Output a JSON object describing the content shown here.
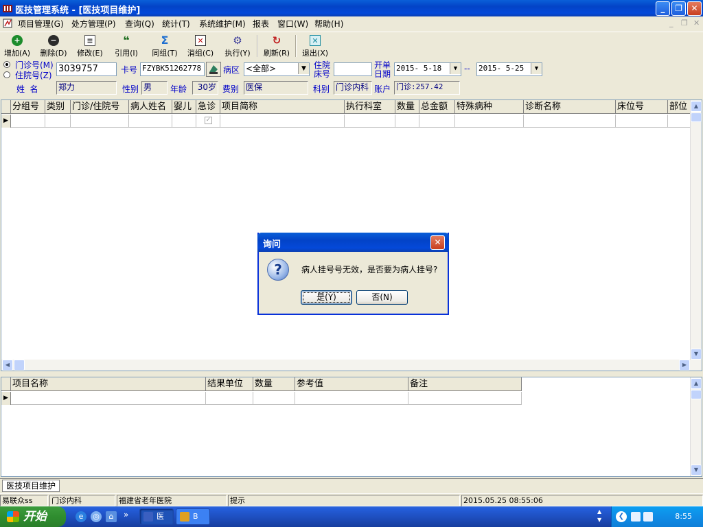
{
  "window": {
    "title": "医技管理系统 - [医技项目维护]",
    "controls": {
      "minimize": "_",
      "restore": "❐",
      "close": "✕"
    }
  },
  "menu": {
    "items": [
      "项目管理(G)",
      "处方管理(P)",
      "查询(Q)",
      "统计(T)",
      "系统维护(M)",
      "报表",
      "窗口(W)",
      "帮助(H)"
    ],
    "mdi_controls": {
      "minimize": "_",
      "restore": "❐",
      "close": "✕"
    }
  },
  "toolbar": {
    "buttons": [
      {
        "label": "增加(A)",
        "icon": "plus-circle-icon",
        "color": "#1C8C2C"
      },
      {
        "label": "删除(D)",
        "icon": "minus-circle-icon",
        "color": "#2C2C2C"
      },
      {
        "label": "修改(E)",
        "icon": "edit-document-icon",
        "color": "#555555"
      },
      {
        "label": "引用(I)",
        "icon": "quote-icon",
        "color": "#1C6C1C"
      },
      {
        "label": "同组(T)",
        "icon": "sigma-icon",
        "color": "#1F6FD0"
      },
      {
        "label": "消组(C)",
        "icon": "delete-group-icon",
        "color": "#C02020"
      },
      {
        "label": "执行(Y)",
        "icon": "gear-icon",
        "color": "#3A3A9A"
      },
      {
        "label": "刷新(R)",
        "icon": "refresh-icon",
        "color": "#C02020"
      },
      {
        "label": "退出(X)",
        "icon": "exit-icon",
        "color": "#1C8CA0"
      }
    ]
  },
  "form": {
    "radio_outpatient": "门诊号(M)",
    "radio_inpatient": "住院号(Z)",
    "patient_no": "3039757",
    "card_label": "卡号",
    "card_no": "FZYBK51262778",
    "ward_label": "病区",
    "ward_value": "<全部>",
    "bed_label_1": "住院",
    "bed_label_2": "床号",
    "bed_value": "",
    "order_date_label_1": "开单",
    "order_date_label_2": "日期",
    "date_from": "2015- 5-18",
    "date_sep": "--",
    "date_to": "2015- 5-25",
    "name_label": "姓  名",
    "name": "郑力",
    "gender_label": "性别",
    "gender": "男",
    "age_label": "年龄",
    "age": "30岁",
    "fee_label": "费别",
    "fee_type": "医保",
    "dept_label": "科别",
    "dept": "门诊内科",
    "account_label": "账户",
    "account": "门诊:257.42"
  },
  "main_grid": {
    "columns": [
      "分组号",
      "类别",
      "门诊/住院号",
      "病人姓名",
      "婴儿",
      "急诊",
      "项目简称",
      "执行科室",
      "数量",
      "总金额",
      "特殊病种",
      "诊断名称",
      "床位号",
      "部位"
    ],
    "emergency_checkbox": "✓"
  },
  "detail_grid": {
    "columns": [
      "项目名称",
      "结果单位",
      "数量",
      "参考值",
      "备注"
    ]
  },
  "dialog": {
    "title": "询问",
    "message": "病人挂号号无效，是否要为病人挂号?",
    "yes": "是(Y)",
    "no": "否(N)",
    "icon_glyph": "?"
  },
  "mdi_tab": "医技项目维护",
  "status": {
    "user": "易联众ss",
    "dept": "门诊内科",
    "hospital": "福建省老年医院",
    "hint": "提示",
    "datetime": "2015.05.25 08:55:06"
  },
  "taskbar": {
    "start": "开始",
    "chevron": "»",
    "tasks": [
      "医",
      "B"
    ],
    "clock": "8:55"
  }
}
